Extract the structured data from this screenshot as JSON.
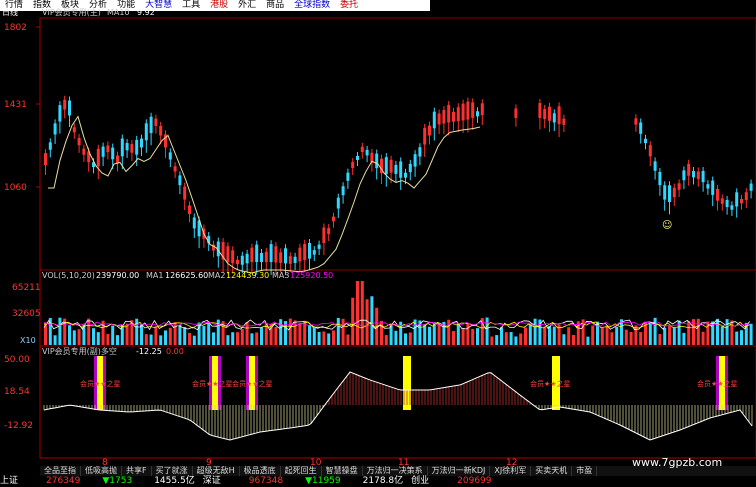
{
  "menu": [
    {
      "label": "行情",
      "color": "#000"
    },
    {
      "label": "指数",
      "color": "#000"
    },
    {
      "label": "板块",
      "color": "#000"
    },
    {
      "label": "分析",
      "color": "#000"
    },
    {
      "label": "功能",
      "color": "#000"
    },
    {
      "label": "大智慧",
      "color": "#00c"
    },
    {
      "label": "工具",
      "color": "#000"
    },
    {
      "label": "港股",
      "color": "#c00"
    },
    {
      "label": "外汇",
      "color": "#000"
    },
    {
      "label": "商品",
      "color": "#000"
    },
    {
      "label": "全球指数",
      "color": "#00c"
    },
    {
      "label": "委托",
      "color": "#c00"
    }
  ],
  "kline": {
    "period": "日线",
    "title": "VIP会员专用(主)",
    "ma_label": "MA10",
    "ma_value": "9.92",
    "y_ticks": [
      "1802",
      "1431",
      "1060"
    ],
    "extra_tick": "X10"
  },
  "volume": {
    "header": "VOL(5,10,20)",
    "v1": "239790.00",
    "ma1_label": "MA1",
    "ma1_value": "126625.60",
    "ma2_label": "MA2",
    "ma2_value": "124439.30",
    "ma3_label": "MA3",
    "ma3_value": "125920.50",
    "y_ticks": [
      "65211",
      "32605",
      "X10"
    ]
  },
  "indicator": {
    "header": "VIP会员专用(副)多空",
    "val1": "-12.25",
    "val2": "0.00",
    "y_ticks": [
      "50.00",
      "18.54",
      "-12.92"
    ],
    "signal_label": "会员★★之星"
  },
  "x_ticks": [
    "8",
    "9",
    "10",
    "11",
    "12"
  ],
  "tabs": [
    "全品至指",
    "低吸高抛",
    "共享F",
    "买了就涨",
    "超级无敌H",
    "极品透底",
    "起死回生",
    "智慧操盘",
    "万法归一决策系",
    "万法归一新KDJ",
    "XJ徐利军",
    "买卖天机",
    "市盈"
  ],
  "status": {
    "index_name": "上证",
    "v1": "276349",
    "v2": "▼1753",
    "v3": "1455.5亿",
    "name2": "深证",
    "v4": "967348",
    "v5": "▼11959",
    "v6": "2178.8亿",
    "name3": "创业",
    "v7": "209699"
  },
  "watermark": "www.7gpzb.com",
  "colors": {
    "up": "#ff3030",
    "down": "#30d8ff",
    "ma": "#e8e0a0",
    "signal_yellow": "#ffff00",
    "signal_purple": "#b000c0"
  }
}
